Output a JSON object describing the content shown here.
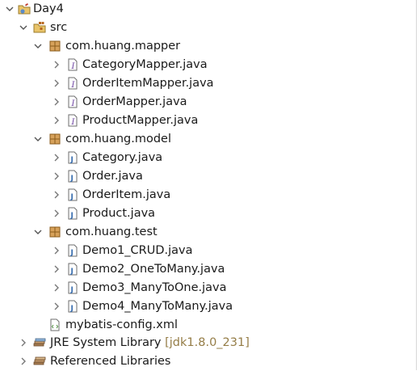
{
  "tree": {
    "project": "Day4",
    "src": "src",
    "packages": [
      {
        "name": "com.huang.mapper",
        "files": [
          "CategoryMapper.java",
          "OrderItemMapper.java",
          "OrderMapper.java",
          "ProductMapper.java"
        ]
      },
      {
        "name": "com.huang.model",
        "files": [
          "Category.java",
          "Order.java",
          "OrderItem.java",
          "Product.java"
        ]
      },
      {
        "name": "com.huang.test",
        "files": [
          "Demo1_CRUD.java",
          "Demo2_OneToMany.java",
          "Demo3_ManyToOne.java",
          "Demo4_ManyToMany.java"
        ]
      }
    ],
    "config_file": "mybatis-config.xml",
    "jre": {
      "label": "JRE System Library",
      "decoration": "[jdk1.8.0_231]"
    },
    "referenced": "Referenced Libraries"
  }
}
